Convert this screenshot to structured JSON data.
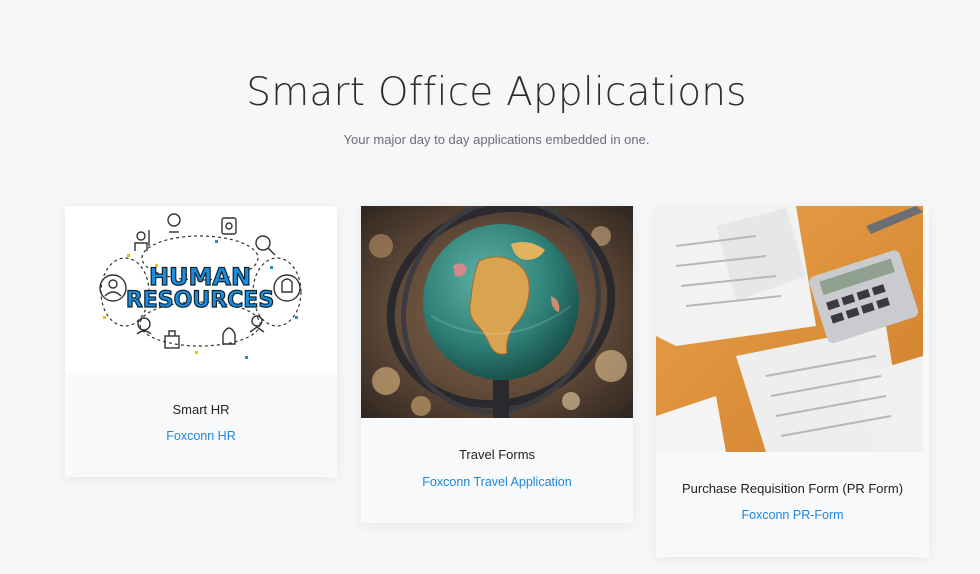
{
  "header": {
    "title": "Smart Office Applications",
    "subtitle": "Your major day to day applications embedded in one."
  },
  "cards": [
    {
      "title": "Smart HR",
      "link": "Foxconn HR",
      "image": "human-resources-illustration",
      "image_text": [
        "HUMAN",
        "RESOURCES"
      ]
    },
    {
      "title": "Travel Forms",
      "link": "Foxconn Travel Application",
      "image": "globe-photo"
    },
    {
      "title": "Purchase Requisition Form (PR Form)",
      "link": "Foxconn PR-Form",
      "image": "documents-calculator-photo"
    }
  ],
  "colors": {
    "background": "#f6f7f9",
    "link": "#1f86d6",
    "hr_text": "#1a8fe0"
  }
}
